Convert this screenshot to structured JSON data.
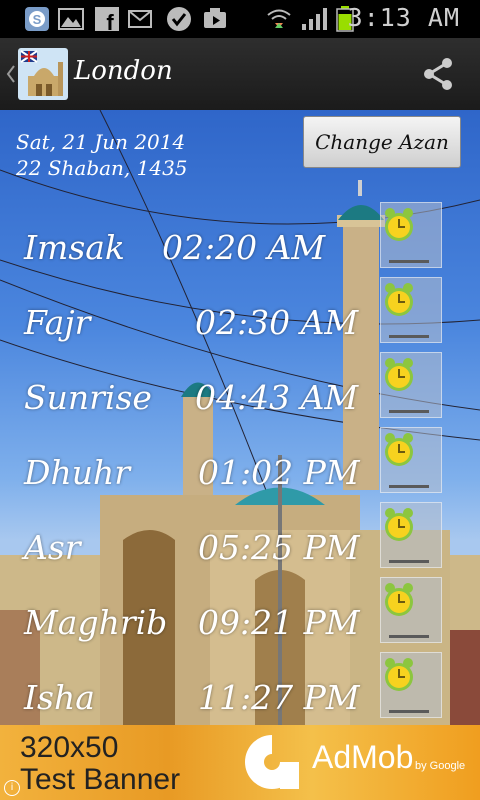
{
  "status_bar": {
    "time": "3:13 AM",
    "icons": [
      "skype-icon",
      "gallery-icon",
      "facebook-icon",
      "email-icon",
      "check-icon",
      "youtube-icon",
      "wifi-icon",
      "signal-icon",
      "battery-icon"
    ]
  },
  "app_bar": {
    "title": "London",
    "icons": [
      "back-chevron-icon",
      "app-logo-icon",
      "share-icon"
    ]
  },
  "header": {
    "gregorian_date": "Sat, 21 Jun 2014",
    "hijri_date": "22 Shaban, 1435",
    "change_azan_label": "Change Azan"
  },
  "prayers": [
    {
      "name": "Imsak",
      "time": "02:20 AM"
    },
    {
      "name": "Fajr",
      "time": "02:30 AM"
    },
    {
      "name": "Sunrise",
      "time": "04:43 AM"
    },
    {
      "name": "Dhuhr",
      "time": "01:02 PM"
    },
    {
      "name": "Asr",
      "time": "05:25 PM"
    },
    {
      "name": "Maghrib",
      "time": "09:21 PM"
    },
    {
      "name": "Isha",
      "time": "11:27 PM"
    }
  ],
  "alarm_icon": "alarm-clock-icon",
  "ad": {
    "line1": "320x50",
    "line2": "Test Banner",
    "brand": "AdMob",
    "byline": "by Google"
  },
  "colors": {
    "sky": "#4b86de",
    "alarm": "#f5d21c",
    "ad_bg": "#e89a24"
  }
}
